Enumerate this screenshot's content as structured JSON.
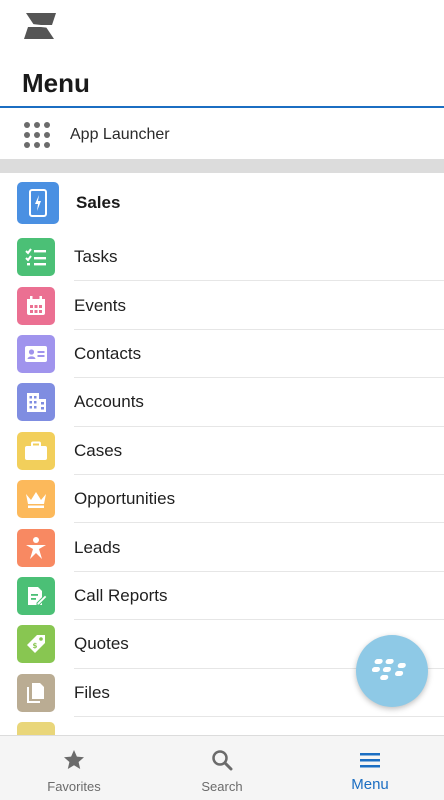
{
  "header": {
    "title": "Menu",
    "logo_icon": "salesforce-s-logo"
  },
  "launcher": {
    "label": "App Launcher",
    "icon": "app-grid-icon"
  },
  "section": {
    "label": "Sales",
    "icon": "phone-lightning-icon",
    "color": "#4a90e2"
  },
  "items": [
    {
      "label": "Tasks",
      "icon": "task-list-icon",
      "color": "#4bc076"
    },
    {
      "label": "Events",
      "icon": "calendar-icon",
      "color": "#eb7092"
    },
    {
      "label": "Contacts",
      "icon": "contact-card-icon",
      "color": "#a094ed"
    },
    {
      "label": "Accounts",
      "icon": "building-icon",
      "color": "#7f8de1"
    },
    {
      "label": "Cases",
      "icon": "briefcase-icon",
      "color": "#f2cf5b"
    },
    {
      "label": "Opportunities",
      "icon": "crown-icon",
      "color": "#fcb95b"
    },
    {
      "label": "Leads",
      "icon": "person-star-icon",
      "color": "#f88962"
    },
    {
      "label": "Call Reports",
      "icon": "report-edit-icon",
      "color": "#4bc076"
    },
    {
      "label": "Quotes",
      "icon": "price-tag-icon",
      "color": "#88c651"
    },
    {
      "label": "Files",
      "icon": "files-icon",
      "color": "#baac93"
    },
    {
      "label": "",
      "icon": "partial-item-icon",
      "color": "#e9d67a"
    }
  ],
  "bottom_nav": [
    {
      "label": "Favorites",
      "icon": "star-icon",
      "active": false
    },
    {
      "label": "Search",
      "icon": "search-icon",
      "active": false
    },
    {
      "label": "Menu",
      "icon": "hamburger-menu-icon",
      "active": true
    }
  ],
  "colors": {
    "accent": "#1b6ec2",
    "fab": "#8ec9e6"
  },
  "fab_icon": "blackberry-logo-icon"
}
